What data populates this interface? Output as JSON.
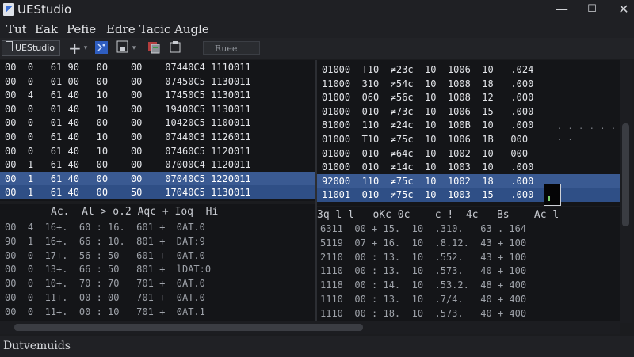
{
  "window": {
    "title": "UEStudio",
    "controls": [
      "—",
      "☐",
      "✕"
    ]
  },
  "menu": [
    "Tut",
    "Eak",
    "Pefie",
    "Edre",
    "Tacic",
    "Augle"
  ],
  "toolbar": {
    "doc_tab": "UEStudio",
    "add_icon": "+",
    "dropdown_glyph": "▾",
    "field_label": "Ruee"
  },
  "left_top_rows": [
    {
      "c1": "00",
      "c2": "0",
      "c3": "61 90",
      "c4": "00",
      "c5": "00",
      "c6": "07440C4",
      "c7": "1110011"
    },
    {
      "c1": "00",
      "c2": "0",
      "c3": "01 00",
      "c4": "00",
      "c5": "00",
      "c6": "07450C5",
      "c7": "1130011"
    },
    {
      "c1": "00",
      "c2": "4",
      "c3": "61 40",
      "c4": "10",
      "c5": "00",
      "c6": "17450C5",
      "c7": "1130011"
    },
    {
      "c1": "00",
      "c2": "0",
      "c3": "01 40",
      "c4": "10",
      "c5": "00",
      "c6": "19400C5",
      "c7": "1130011"
    },
    {
      "c1": "00",
      "c2": "0",
      "c3": "01 40",
      "c4": "00",
      "c5": "00",
      "c6": "10420C5",
      "c7": "1100011"
    },
    {
      "c1": "00",
      "c2": "0",
      "c3": "61 40",
      "c4": "10",
      "c5": "00",
      "c6": "07440C3",
      "c7": "1126011"
    },
    {
      "c1": "00",
      "c2": "0",
      "c3": "61 40",
      "c4": "10",
      "c5": "00",
      "c6": "07460C5",
      "c7": "1120011"
    },
    {
      "c1": "00",
      "c2": "1",
      "c3": "61 40",
      "c4": "00",
      "c5": "00",
      "c6": "07000C4",
      "c7": "1120011"
    },
    {
      "c1": "00",
      "c2": "1",
      "c3": "61 40",
      "c4": "00",
      "c5": "00",
      "c6": "07040C5",
      "c7": "1220011"
    },
    {
      "c1": "00",
      "c2": "1",
      "c3": "61 40",
      "c4": "00",
      "c5": "50",
      "c6": "17040C5",
      "c7": "1130011"
    }
  ],
  "right_top_rows": [
    {
      "a": "01000",
      "b": "T10",
      "c": "≠23c",
      "d": "10",
      "e": "1006",
      "f": "10",
      "g": ".024"
    },
    {
      "a": "11000",
      "b": "310",
      "c": "≠54c",
      "d": "10",
      "e": "1008",
      "f": "18",
      "g": ".000"
    },
    {
      "a": "01000",
      "b": "060",
      "c": "≠56c",
      "d": "10",
      "e": "1008",
      "f": "12",
      "g": ".000"
    },
    {
      "a": "01000",
      "b": "010",
      "c": "≠73c",
      "d": "10",
      "e": "1006",
      "f": "15",
      "g": ".000"
    },
    {
      "a": "81000",
      "b": "110",
      "c": "≠24c",
      "d": "10",
      "e": "100B",
      "f": "10",
      "g": ".000"
    },
    {
      "a": "01000",
      "b": "T10",
      "c": "≠75c",
      "d": "10",
      "e": "1006",
      "f": "1B",
      "g": "000"
    },
    {
      "a": "01000",
      "b": "010",
      "c": "≠64c",
      "d": "10",
      "e": "1002",
      "f": "10",
      "g": "000"
    },
    {
      "a": "01000",
      "b": "010",
      "c": "≠14c",
      "d": "10",
      "e": "1003",
      "f": "10",
      "g": ".000"
    },
    {
      "a": "92000",
      "b": "110",
      "c": "≠75c",
      "d": "10",
      "e": "1002",
      "f": "18",
      "g": ".000"
    },
    {
      "a": "11001",
      "b": "010",
      "c": "≠75c",
      "d": "10",
      "e": "1003",
      "f": "15",
      "g": ".000"
    }
  ],
  "left_bottom_header": "Ac.  Al > o.2 Aqc + Ioq  Hi",
  "left_bottom_rows": [
    {
      "c1": "00",
      "c2": "4",
      "c3": "16+.",
      "c4": "60",
      "c5": ": 16.",
      "c6": "601",
      "c7": "+",
      "c8": "0AT.0"
    },
    {
      "c1": "90",
      "c2": "1",
      "c3": "16+.",
      "c4": "66",
      "c5": ": 10.",
      "c6": "801",
      "c7": "+",
      "c8": "DAT:9"
    },
    {
      "c1": "00",
      "c2": "0",
      "c3": "17+.",
      "c4": "56",
      "c5": ": 50",
      "c6": "601",
      "c7": "+",
      "c8": "0AT.0"
    },
    {
      "c1": "00",
      "c2": "0",
      "c3": "13+.",
      "c4": "66",
      "c5": ": 50",
      "c6": "801",
      "c7": "+",
      "c8": "lDAT:0"
    },
    {
      "c1": "00",
      "c2": "0",
      "c3": "10+.",
      "c4": "70",
      "c5": ": 70",
      "c6": "701",
      "c7": "+",
      "c8": "0AT.0"
    },
    {
      "c1": "00",
      "c2": "0",
      "c3": "11+.",
      "c4": "00",
      "c5": ": 00",
      "c6": "701",
      "c7": "+",
      "c8": "0AT.0"
    },
    {
      "c1": "00",
      "c2": "0",
      "c3": "11+.",
      "c4": "00",
      "c5": ": 10",
      "c6": "701",
      "c7": "+",
      "c8": "0AT.1"
    }
  ],
  "right_bottom_header": "3q l l   oKc 0c    c !  4c   Bs    Ac l",
  "right_bottom_rows": [
    {
      "a": "6311",
      "b": "00 + 15.",
      "c": "10",
      "d": ".310.",
      "e": "63",
      "f": ".",
      "g": "164"
    },
    {
      "a": "5119",
      "b": "07 + 16.",
      "c": "10",
      "d": ".8.12.",
      "e": "43",
      "f": "+",
      "g": "100"
    },
    {
      "a": "2110",
      "b": "00 : 13.",
      "c": "10",
      "d": ".552.",
      "e": "43",
      "f": "+",
      "g": "100"
    },
    {
      "a": "1110",
      "b": "00 : 13.",
      "c": "10",
      "d": ".573.",
      "e": "40",
      "f": "+",
      "g": "100"
    },
    {
      "a": "1118",
      "b": "00 : 14.",
      "c": "10",
      "d": ".53.2.",
      "e": "48",
      "f": "+",
      "g": "400"
    },
    {
      "a": "1110",
      "b": "00 : 13.",
      "c": "10",
      "d": ".7/4.",
      "e": "40",
      "f": "+",
      "g": "400"
    },
    {
      "a": "1110",
      "b": "00 : 18.",
      "c": "10",
      "d": ".573.",
      "e": "40",
      "f": "+",
      "g": "400"
    }
  ],
  "status": "Dutvemuids",
  "colors": {
    "selection": "#3a5a92",
    "background": "#141518",
    "chrome": "#1f2024"
  }
}
